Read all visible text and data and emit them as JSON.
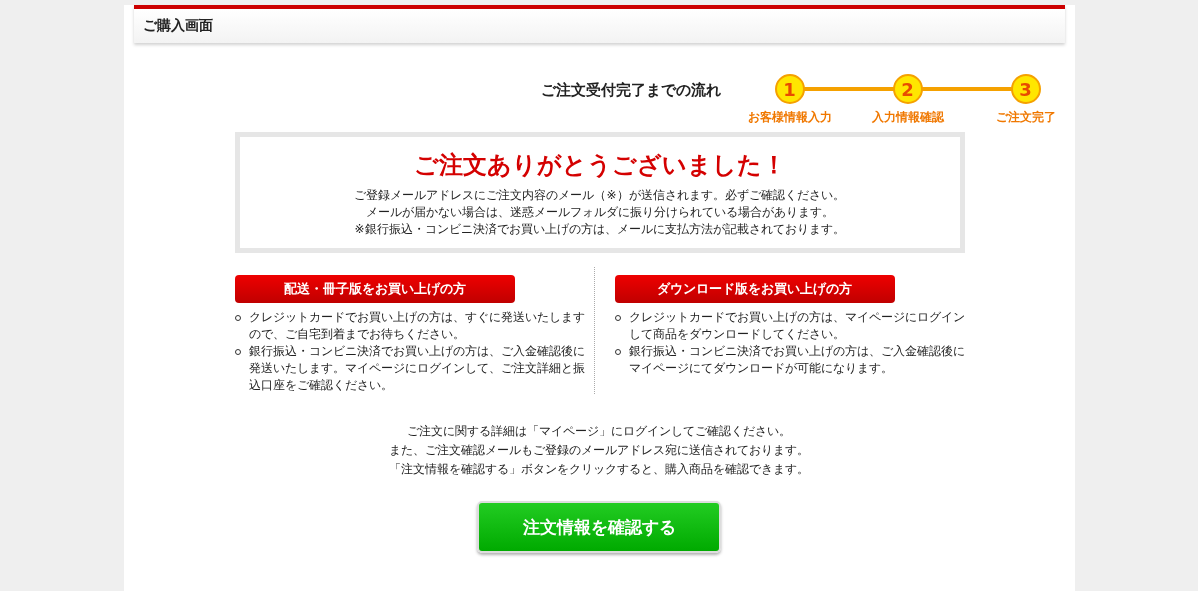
{
  "header": {
    "title": "ご購入画面"
  },
  "flow": {
    "title": "ご注文受付完了までの流れ",
    "steps": [
      {
        "number": "1",
        "label": "お客様情報入力"
      },
      {
        "number": "2",
        "label": "入力情報確認"
      },
      {
        "number": "3",
        "label": "ご注文完了"
      }
    ]
  },
  "thanks": {
    "heading": "ご注文ありがとうございました！",
    "lines": [
      "ご登録メールアドレスにご注文内容のメール（※）が送信されます。必ずご確認ください。",
      "メールが届かない場合は、迷惑メールフォルダに振り分けられている場合があります。",
      "※銀行振込・コンビニ決済でお買い上げの方は、メールに支払方法が記載されております。"
    ]
  },
  "columns": [
    {
      "heading": "配送・冊子版をお買い上げの方",
      "items": [
        "クレジットカードでお買い上げの方は、すぐに発送いたしますので、ご自宅到着までお待ちください。",
        "銀行振込・コンビニ決済でお買い上げの方は、ご入金確認後に発送いたします。マイページにログインして、ご注文詳細と振込口座をご確認ください。"
      ]
    },
    {
      "heading": "ダウンロード版をお買い上げの方",
      "items": [
        "クレジットカードでお買い上げの方は、マイページにログインして商品をダウンロードしてください。",
        "銀行振込・コンビニ決済でお買い上げの方は、ご入金確認後にマイページにてダウンロードが可能になります。"
      ]
    }
  ],
  "notes": [
    "ご注文に関する詳細は「マイページ」にログインしてご確認ください。",
    "また、ご注文確認メールもご登録のメールアドレス宛に送信されております。",
    "「注文情報を確認する」ボタンをクリックすると、購入商品を確認できます。"
  ],
  "button": {
    "label": "注文情報を確認する"
  }
}
